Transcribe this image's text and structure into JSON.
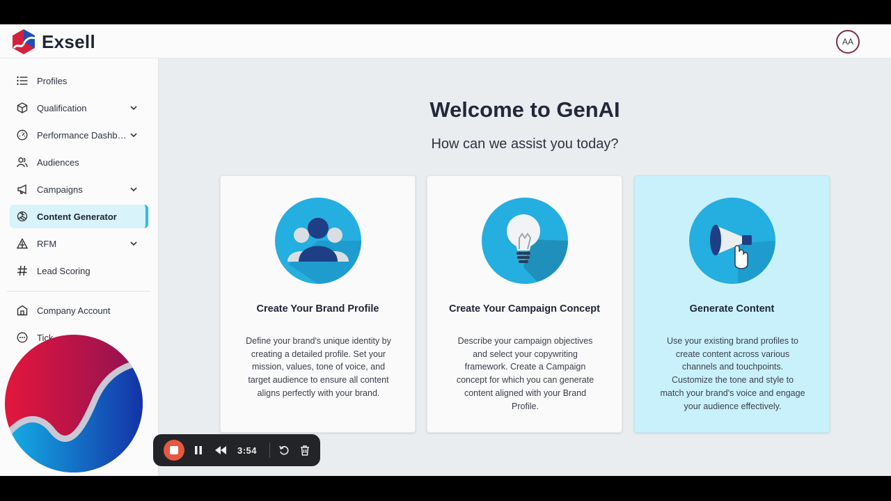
{
  "app": {
    "brand": "Exsell",
    "user_initials": "AA"
  },
  "sidebar": {
    "items": [
      {
        "label": "Profiles",
        "icon": "list-icon",
        "has_children": false
      },
      {
        "label": "Qualification",
        "icon": "cube-icon",
        "has_children": true
      },
      {
        "label": "Performance Dashbo…",
        "icon": "gauge-icon",
        "has_children": true
      },
      {
        "label": "Audiences",
        "icon": "users-icon",
        "has_children": false
      },
      {
        "label": "Campaigns",
        "icon": "megaphone-icon",
        "has_children": true
      },
      {
        "label": "Content Generator",
        "icon": "openai-icon",
        "has_children": false,
        "active": true
      },
      {
        "label": "RFM",
        "icon": "triangle-icon",
        "has_children": true
      },
      {
        "label": "Lead Scoring",
        "icon": "hash-icon",
        "has_children": false
      }
    ],
    "bottom_items": [
      {
        "label": "Company Account",
        "icon": "building-icon"
      },
      {
        "label": "Tick",
        "icon": "chat-icon"
      }
    ]
  },
  "main": {
    "title": "Welcome to GenAI",
    "subtitle": "How can we assist you today?",
    "cards": [
      {
        "title": "Create Your Brand Profile",
        "desc_lines": [
          "Define your brand's unique identity by",
          "creating a detailed profile. Set your",
          "mission, values, tone of voice, and",
          "target audience to ensure all content",
          "aligns perfectly with your brand."
        ],
        "icon": "people-icon"
      },
      {
        "title": "Create Your Campaign Concept",
        "desc_lines": [
          "Describe your campaign objectives",
          "and select your copywriting",
          "framework. Create a Campaign",
          "concept for which you can generate",
          "content aligned with your Brand",
          "Profile."
        ],
        "icon": "lightbulb-icon"
      },
      {
        "title": "Generate Content",
        "desc_lines": [
          "Use your existing brand profiles to",
          "create content across various",
          "channels and touchpoints.",
          "Customize the tone and style to",
          "match your brand's voice and engage",
          "your audience effectively."
        ],
        "icon": "megaphone-hand-icon",
        "highlighted": true
      }
    ]
  },
  "recorder": {
    "time": "3:54"
  },
  "colors": {
    "accent": "#25bde6",
    "active_bg": "#d8f3fa",
    "highlight_card": "#c9f1fc",
    "record": "#e8573f"
  }
}
